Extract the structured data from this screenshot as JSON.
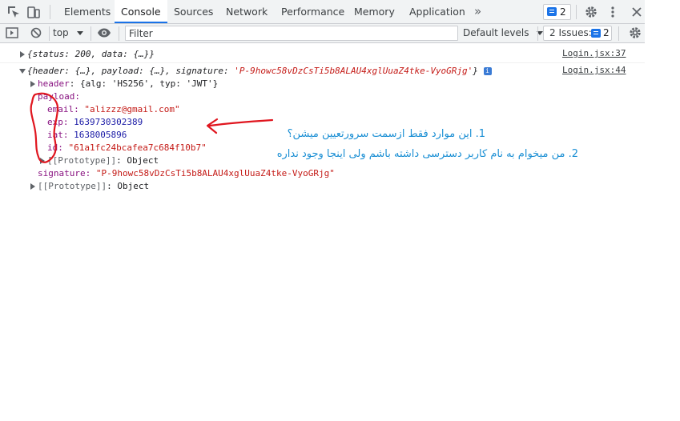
{
  "tabs": [
    {
      "label": "Elements"
    },
    {
      "label": "Console"
    },
    {
      "label": "Sources"
    },
    {
      "label": "Network"
    },
    {
      "label": "Performance"
    },
    {
      "label": "Memory"
    },
    {
      "label": "Application"
    }
  ],
  "more_tabs": "»",
  "issue_count_top": "2",
  "toolbar": {
    "context": "top",
    "filter_placeholder": "Filter",
    "levels": "Default levels",
    "issues_label": "2 Issues:",
    "issues_count": "2"
  },
  "log1": {
    "summary": "{status: 200, data: {…}}",
    "source": "Login.jsx:37"
  },
  "log2": {
    "prefix": "{header: {…}, payload: {…}, signature: ",
    "sig_value": "'P-9howc58vDzCsTi5b8ALAU4xglUuaZ4tke-VyoGRjg'",
    "suffix": "}",
    "source": "Login.jsx:44",
    "header_key": "header",
    "header_value": "{alg: 'HS256', typ: 'JWT'}",
    "payload_key": "payload:",
    "email_key": "email:",
    "email_value": "\"alizzz@gmail.com\"",
    "exp_key": "exp:",
    "exp_value": "1639730302389",
    "iat_key": "iat:",
    "iat_value": "1638005896",
    "id_key": "id:",
    "id_value": "\"61a1fc24bcafea7c684f10b7\"",
    "proto_inner": "[[Prototype]]",
    "proto_inner_value": "Object",
    "signature_key": "signature:",
    "signature_value": "\"P-9howc58vDzCsTi5b8ALAU4xglUuaZ4tke-VyoGRjg\"",
    "proto_outer": "[[Prototype]]",
    "proto_outer_value": "Object"
  },
  "annotation": {
    "line1": "1. این موارد فقط ازسمت سرورتعیین میشن؟",
    "line2": "2. من میخوام به نام کاربر دسترسی داشته باشم ولی اینجا وجود نداره",
    "color": "#1b8fd4",
    "mark_color": "#e0161f"
  }
}
